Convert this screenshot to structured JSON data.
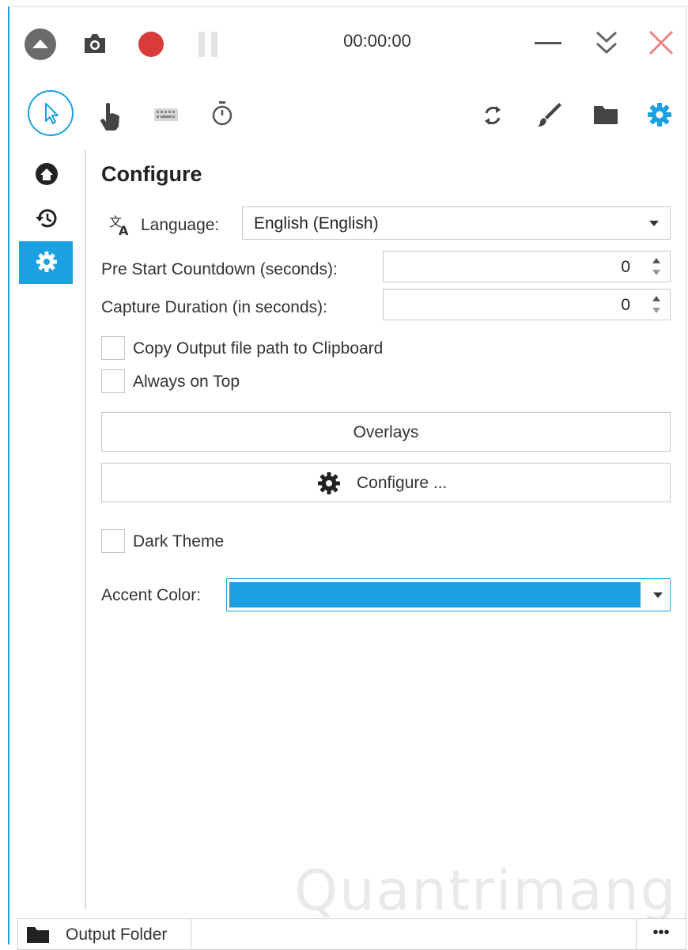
{
  "titlebar": {
    "timer": "00:00:00",
    "icons": [
      "collapse-up-icon",
      "screenshot-camera-icon",
      "record-icon",
      "pause-icon",
      "minimize-icon",
      "double-chevron-down-icon",
      "close-icon"
    ]
  },
  "toolbar": {
    "icons": [
      "mouse-pointer-icon",
      "hand-click-icon",
      "keyboard-icon",
      "stopwatch-icon",
      "refresh-icon",
      "brush-icon",
      "folder-icon",
      "settings-gear-icon"
    ]
  },
  "sidebar": {
    "items": [
      {
        "icon": "home-icon",
        "active": false
      },
      {
        "icon": "history-icon",
        "active": false
      },
      {
        "icon": "settings-gear-icon",
        "active": true
      }
    ]
  },
  "configure": {
    "title": "Configure",
    "language_label": "Language:",
    "language_value": "English (English)",
    "countdown_label": "Pre Start Countdown (seconds):",
    "countdown_value": "0",
    "duration_label": "Capture Duration (in seconds):",
    "duration_value": "0",
    "copy_path_label": "Copy Output file path to Clipboard",
    "always_on_top_label": "Always on Top",
    "overlays_button": "Overlays",
    "configure_button": "Configure ...",
    "dark_theme_label": "Dark Theme",
    "accent_label": "Accent Color:"
  },
  "colors": {
    "accent": "#1ba1e2",
    "record": "#d93a3a",
    "close": "#f08080"
  },
  "statusbar": {
    "output_folder": "Output Folder",
    "more": "•••"
  },
  "watermark": "Quantrimang"
}
